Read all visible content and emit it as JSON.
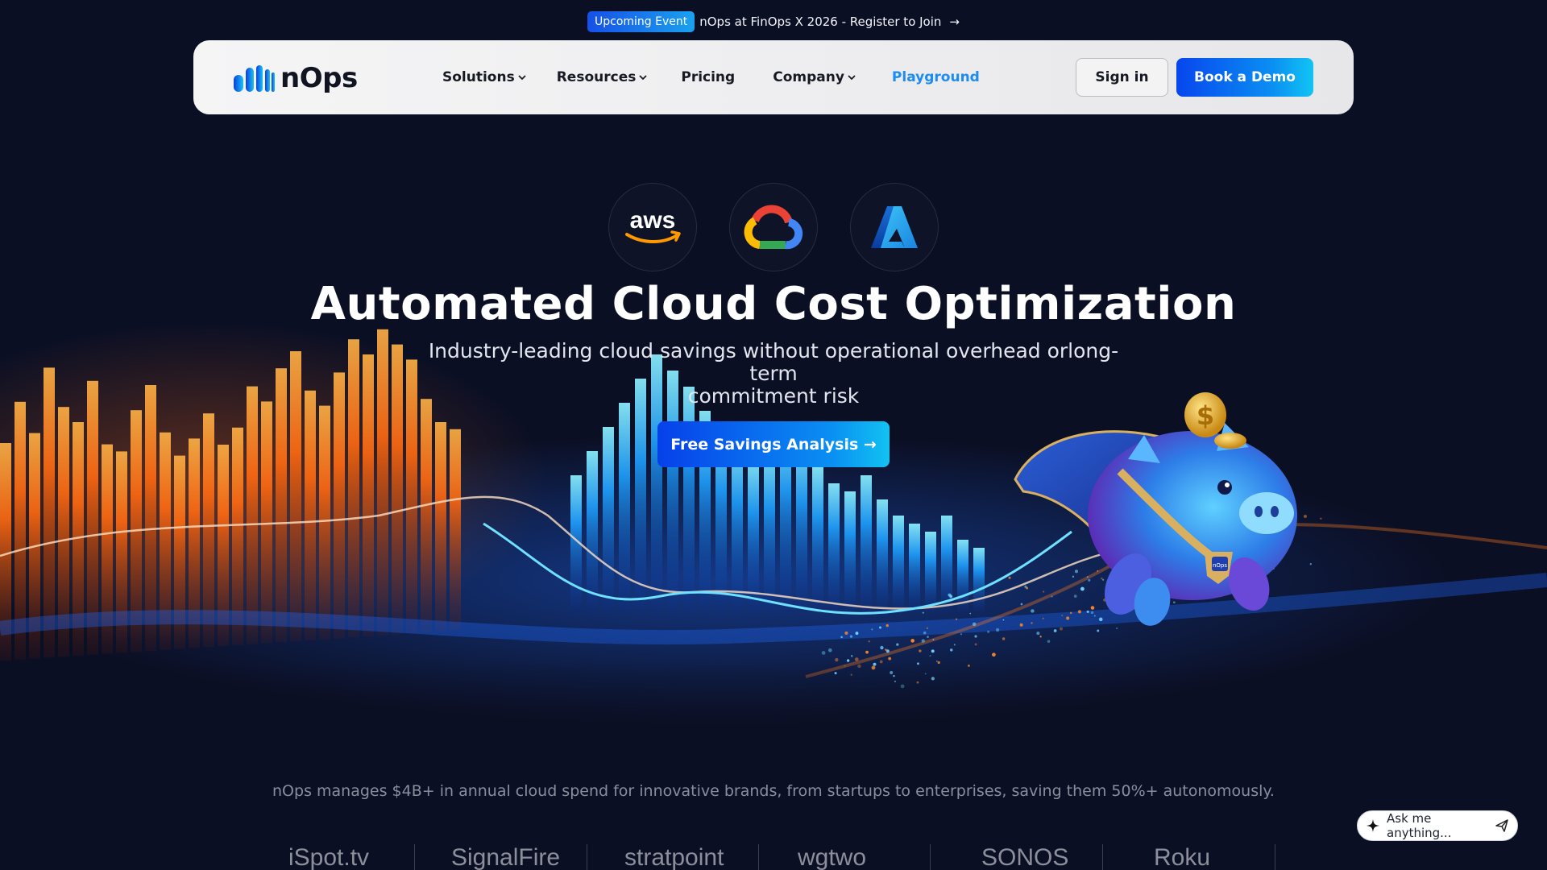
{
  "announcement": {
    "badge": "Upcoming Event",
    "text": "nOps at FinOps X 2026 - Register to Join",
    "arrow_icon": "arrow-right-icon"
  },
  "navbar": {
    "logo_text": "nOps",
    "items": [
      {
        "label": "Solutions",
        "has_dropdown": true
      },
      {
        "label": "Resources",
        "has_dropdown": true
      },
      {
        "label": "Pricing",
        "has_dropdown": false
      },
      {
        "label": "Company",
        "has_dropdown": true
      },
      {
        "label": "Playground",
        "has_dropdown": false,
        "color": "#1c8cf0"
      }
    ],
    "signin_label": "Sign in",
    "demo_label": "Book a Demo"
  },
  "providers": [
    {
      "name": "aws",
      "label": "aws",
      "icon": "aws-icon"
    },
    {
      "name": "google-cloud",
      "icon": "google-cloud-icon"
    },
    {
      "name": "azure",
      "icon": "azure-icon"
    }
  ],
  "hero": {
    "title": "Automated Cloud Cost Optimization",
    "subtitle_line1": "Industry-leading cloud savings without operational overhead orlong-term",
    "subtitle_line2": "commitment risk",
    "cta_label": "Free Savings Analysis →"
  },
  "mascot": {
    "icon": "piggy-bank-mascot-icon",
    "badge_text": "nOps"
  },
  "stats_text": "nOps manages $4B+ in annual cloud spend for innovative brands, from startups to enterprises, saving them 50%+ autonomously.",
  "customer_logos": [
    "iSpot.tv",
    "SignalFire",
    "stratpoint",
    "wgtwo",
    "SONOS",
    "Roku"
  ],
  "chat": {
    "placeholder": "Ask me anything...",
    "spark_icon": "sparkle-icon",
    "send_icon": "send-icon"
  },
  "colors": {
    "background": "#0b0f24",
    "accent_blue": "#0746ee",
    "accent_cyan": "#12c4f4",
    "bars_orange": "#ff7a1a",
    "bars_blue": "#2aa8ff"
  }
}
